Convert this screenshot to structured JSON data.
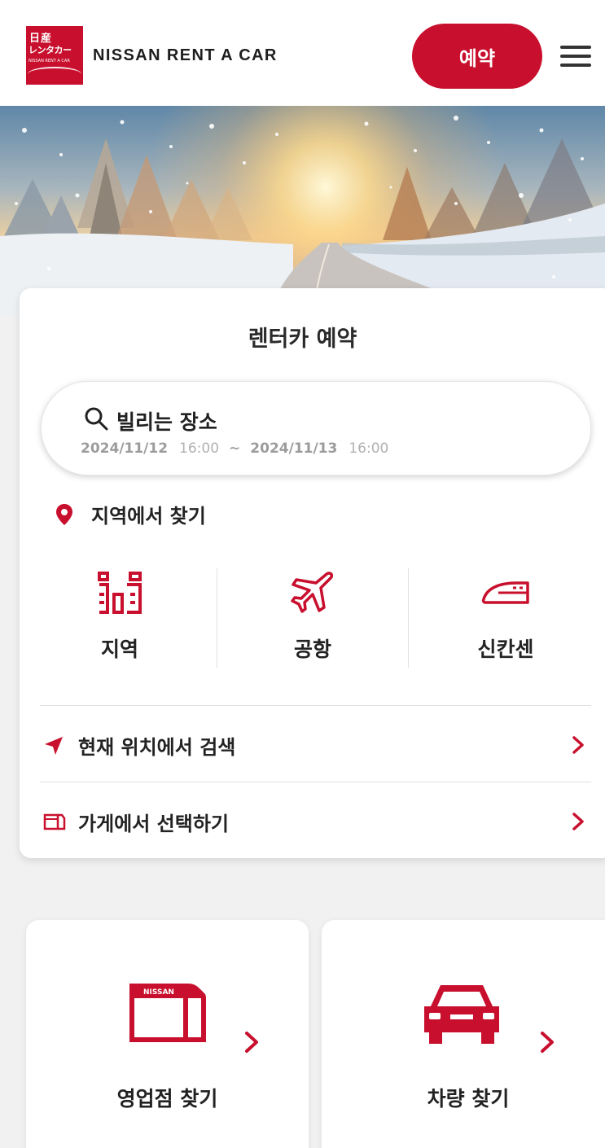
{
  "header": {
    "logo": {
      "line1": "日産",
      "line2": "レンタカー",
      "line3": "NISSAN RENT A CAR"
    },
    "brand": "NISSAN RENT A CAR",
    "reserve_label": "예약",
    "menu_icon": "hamburger-icon"
  },
  "colors": {
    "accent": "#c8102e",
    "text": "#222222",
    "muted": "#a3a3a3"
  },
  "booking": {
    "title": "렌터카 예약",
    "search": {
      "label": "빌리는 장소",
      "start_date": "2024/11/12",
      "start_time": "16:00",
      "separator": "~",
      "end_date": "2024/11/13",
      "end_time": "16:00"
    },
    "region_find_label": "지역에서 찾기",
    "categories": [
      {
        "label": "지역",
        "icon": "region-buildings-icon"
      },
      {
        "label": "공항",
        "icon": "airplane-icon"
      },
      {
        "label": "신칸센",
        "icon": "shinkansen-icon"
      }
    ],
    "rows": [
      {
        "label": "현재 위치에서 검색",
        "icon": "location-arrow-icon"
      },
      {
        "label": "가게에서 선택하기",
        "icon": "store-icon"
      }
    ]
  },
  "tiles": [
    {
      "label": "영업점 찾기",
      "icon": "store-sign-icon",
      "sign_text": "NISSAN"
    },
    {
      "label": "차량 찾기",
      "icon": "car-icon"
    }
  ]
}
